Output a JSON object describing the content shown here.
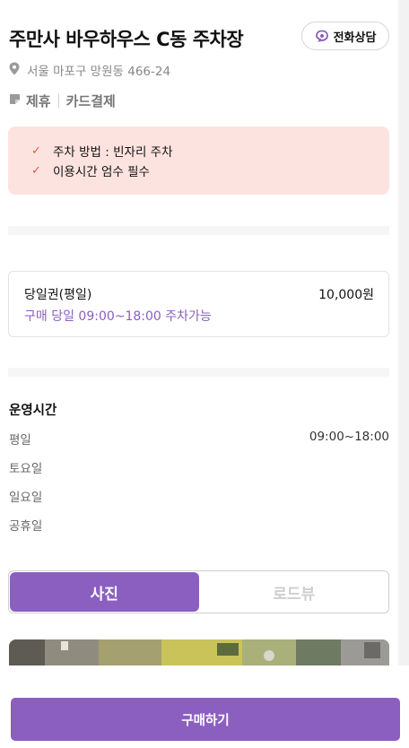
{
  "header": {
    "title": "주만사 바우하우스 C동 주차장",
    "call_button_label": "전화상담"
  },
  "address": "서울 마포구 망원동 466-24",
  "tags": [
    "제휴",
    "카드결제"
  ],
  "notices": [
    "주차 방법 : 빈자리 주차",
    "이용시간 엄수 필수"
  ],
  "ticket": {
    "name": "당일권(평일)",
    "price": "10,000원",
    "description": "구매 당일 09:00~18:00 주차가능"
  },
  "hours": {
    "title": "운영시간",
    "rows": [
      {
        "day": "평일",
        "time": "09:00~18:00"
      },
      {
        "day": "토요일",
        "time": ""
      },
      {
        "day": "일요일",
        "time": ""
      },
      {
        "day": "공휴일",
        "time": ""
      }
    ]
  },
  "tabs": {
    "active": "사진",
    "inactive": "로드뷰"
  },
  "buy_button_label": "구매하기",
  "colors": {
    "accent": "#8b5fbf",
    "notice_bg": "#fde3df",
    "check": "#e05a4a"
  }
}
